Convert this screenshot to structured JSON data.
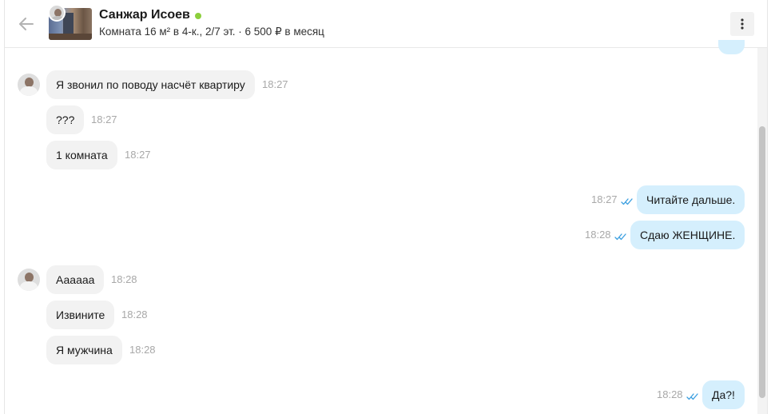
{
  "header": {
    "name": "Санжар Исоев",
    "subtitle": "Комната 16 м² в 4-к., 2/7 эт. · 6 500 ₽ в месяц",
    "online_color": "#8ccf3c",
    "back_icon": "arrow-left-icon",
    "menu_icon": "more-vertical-icon"
  },
  "colors": {
    "incoming_bubble": "#f2f2f2",
    "outgoing_bubble": "#d5effd",
    "time_text": "#a8a8a8",
    "read_check": "#3b9fe0"
  },
  "messages": [
    {
      "direction": "in",
      "text": "Я звонил по поводу насчёт квартиру",
      "time": "18:27",
      "avatar": true
    },
    {
      "direction": "in",
      "text": "???",
      "time": "18:27"
    },
    {
      "direction": "in",
      "text": "1 комната",
      "time": "18:27"
    },
    {
      "direction": "out",
      "text": "Читайте дальше.",
      "time": "18:27",
      "read": true
    },
    {
      "direction": "out",
      "text": "Сдаю ЖЕНЩИНЕ.",
      "time": "18:28",
      "read": true
    },
    {
      "direction": "in",
      "text": "Аааааа",
      "time": "18:28",
      "avatar": true
    },
    {
      "direction": "in",
      "text": "Извините",
      "time": "18:28"
    },
    {
      "direction": "in",
      "text": "Я мужчина",
      "time": "18:28"
    },
    {
      "direction": "out",
      "text": "Да?!",
      "time": "18:28",
      "read": true
    }
  ]
}
